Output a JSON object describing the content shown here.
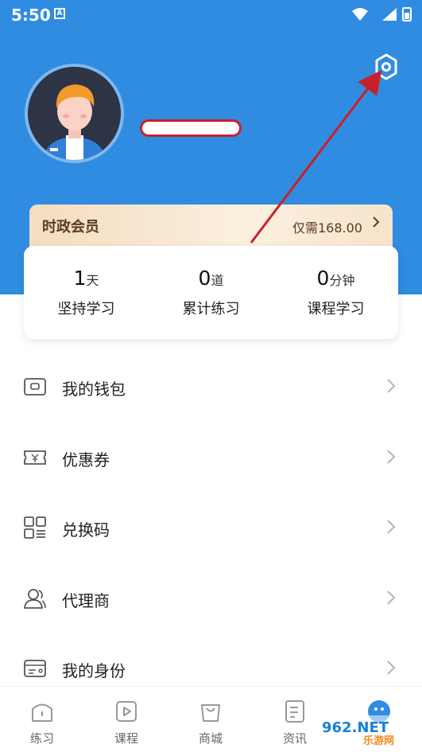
{
  "status_bar": {
    "time": "5:50",
    "notification_letter": "A"
  },
  "member_card": {
    "title": "时政会员",
    "price": "仅需168.00"
  },
  "stats": [
    {
      "value": "1",
      "unit": "天",
      "label": "坚持学习"
    },
    {
      "value": "0",
      "unit": "道",
      "label": "累计练习"
    },
    {
      "value": "0",
      "unit": "分钟",
      "label": "课程学习"
    }
  ],
  "menu": [
    {
      "label": "我的钱包",
      "icon": "wallet-icon"
    },
    {
      "label": "优惠券",
      "icon": "coupon-icon"
    },
    {
      "label": "兑换码",
      "icon": "qr-code-icon"
    },
    {
      "label": "代理商",
      "icon": "agent-icon"
    },
    {
      "label": "我的身份",
      "icon": "id-card-icon"
    }
  ],
  "tabs": [
    {
      "label": "练习",
      "icon": "practice-icon"
    },
    {
      "label": "课程",
      "icon": "course-icon"
    },
    {
      "label": "商城",
      "icon": "shop-icon"
    },
    {
      "label": "资讯",
      "icon": "news-icon"
    },
    {
      "label": "",
      "icon": "profile-icon"
    }
  ],
  "watermark": {
    "text": "962.NET",
    "subtext": "乐游网"
  },
  "colors": {
    "header_blue": "#2f8ce0",
    "annotation_red": "#c8202a",
    "member_brown": "#5b3d1e"
  }
}
